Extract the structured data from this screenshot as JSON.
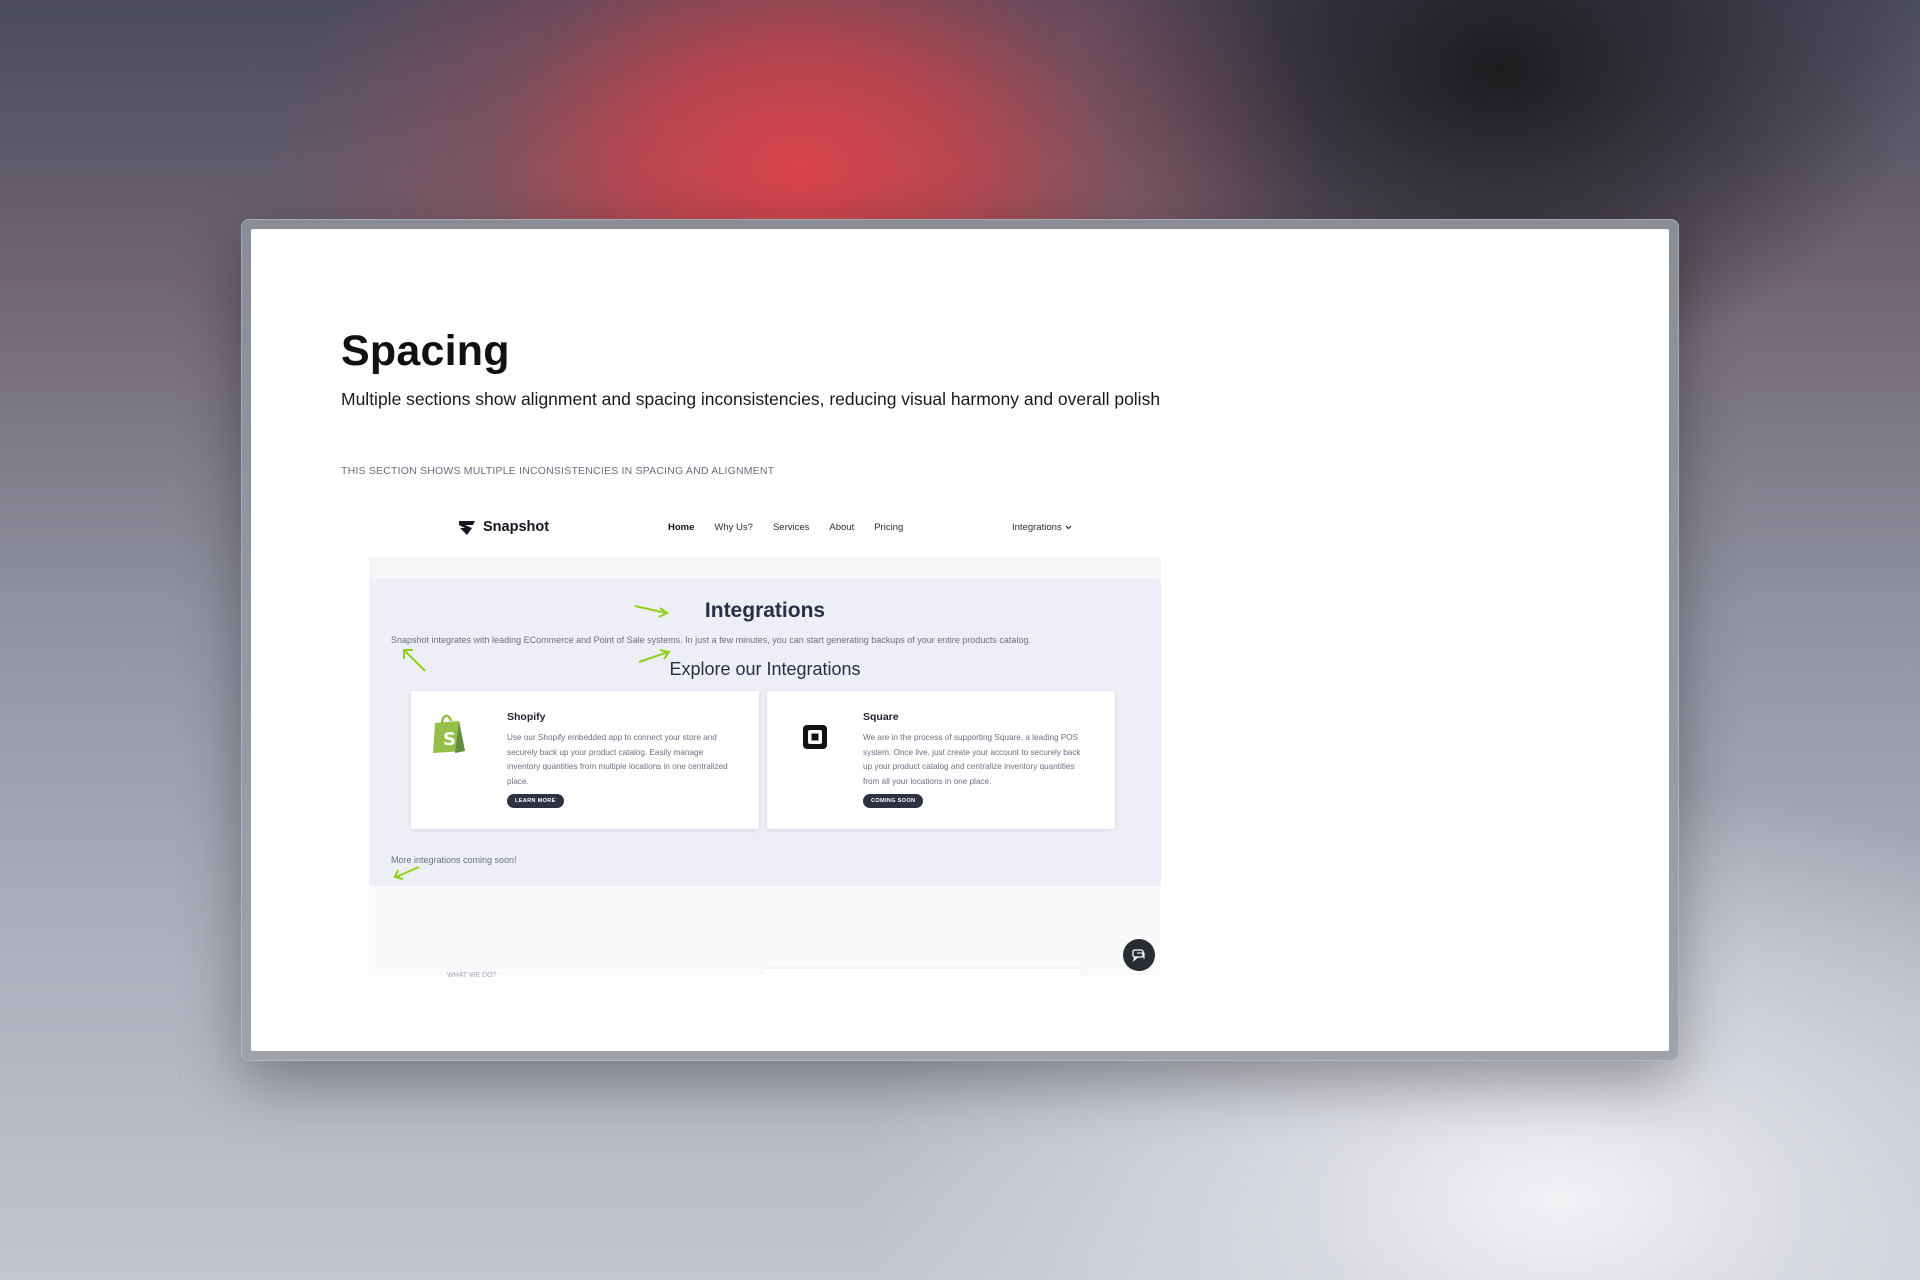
{
  "slide": {
    "title": "Spacing",
    "subtitle": "Multiple sections show alignment and spacing inconsistencies, reducing visual harmony and overall polish",
    "caption": "THIS SECTION SHOWS MULTIPLE INCONSISTENCIES IN SPACING AND ALIGNMENT"
  },
  "screenshot": {
    "nav": {
      "logo_text": "Snapshot",
      "links": [
        "Home",
        "Why Us?",
        "Services",
        "About",
        "Pricing"
      ],
      "integrations_label": "Integrations"
    },
    "integrations": {
      "title": "Integrations",
      "description": "Snapshot integrates with leading ECommerce and Point of Sale systems. In just a few minutes, you can start generating backups of your entire products catalog.",
      "subtitle": "Explore our Integrations",
      "cards": [
        {
          "title": "Shopify",
          "text": "Use our Shopify embedded app to connect your store and securely back up your product catalog. Easily manage inventory quantities from multiple locations in one centralized place.",
          "button": "LEARN MORE",
          "icon": "shopify-icon"
        },
        {
          "title": "Square",
          "text": "We are in the process of supporting Square, a leading POS system. Once live, just create your account to securely back up your product catalog and centralize inventory quantities from all your locations in one place.",
          "button": "COMING SOON",
          "icon": "square-icon"
        }
      ],
      "footer": "More integrations coming soon!"
    },
    "lower": {
      "label": "WHAT WE DO?"
    },
    "colors": {
      "annotation_arrow": "#8fd11a",
      "band_bg": "#eeeff6",
      "button_bg": "#2d3142"
    }
  }
}
